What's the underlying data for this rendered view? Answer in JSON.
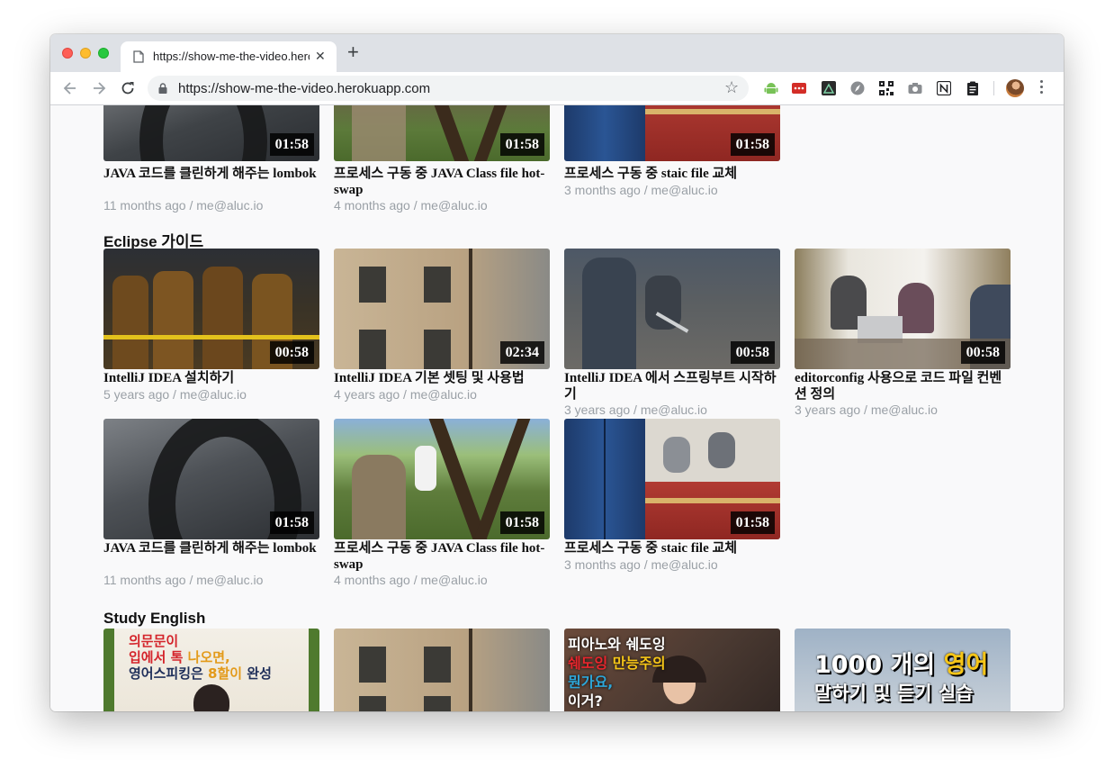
{
  "browser": {
    "tab_title": "https://show-me-the-video.herokuapp.com",
    "url": "https://show-me-the-video.herokuapp.com",
    "tab_close": "✕",
    "new_tab": "+",
    "star": "☆",
    "extensions": [
      "android-icon",
      "lastpass-icon",
      "mountain-icon",
      "compass-icon",
      "qr-code-icon",
      "camera-icon",
      "notion-icon",
      "clipboard-icon"
    ]
  },
  "sections": {
    "top": {
      "videos": [
        {
          "title": "JAVA 코드를 클린하게 해주는 lombok",
          "meta": "11 months ago / me@aluc.io",
          "duration": "01:58"
        },
        {
          "title": "프로세스 구동 중 JAVA Class file hot-swap",
          "meta": "4 months ago / me@aluc.io",
          "duration": "01:58"
        },
        {
          "title": "프로세스 구동 중 staic file 교체",
          "meta": "3 months ago / me@aluc.io",
          "duration": "01:58"
        }
      ]
    },
    "eclipse": {
      "title": "Eclipse 가이드",
      "videos": [
        {
          "title": "IntelliJ IDEA 설치하기",
          "meta": "5 years ago / me@aluc.io",
          "duration": "00:58"
        },
        {
          "title": "IntelliJ IDEA 기본 셋팅 및 사용법",
          "meta": "4 years ago / me@aluc.io",
          "duration": "02:34"
        },
        {
          "title": "IntelliJ IDEA 에서 스프링부트 시작하기",
          "meta": "3 years ago / me@aluc.io",
          "duration": "00:58"
        },
        {
          "title": "editorconfig 사용으로 코드 파일 컨벤션 정의",
          "meta": "3 years ago / me@aluc.io",
          "duration": "00:58"
        },
        {
          "title": "JAVA 코드를 클린하게 해주는 lombok",
          "meta": "11 months ago / me@aluc.io",
          "duration": "01:58"
        },
        {
          "title": "프로세스 구동 중 JAVA Class file hot-swap",
          "meta": "4 months ago / me@aluc.io",
          "duration": "01:58"
        },
        {
          "title": "프로세스 구동 중 staic file 교체",
          "meta": "3 months ago / me@aluc.io",
          "duration": "01:58"
        }
      ]
    },
    "english": {
      "title": "Study English",
      "thumb_texts": {
        "t1_a": "의문문이",
        "t1_b1": "입에서 ",
        "t1_b2": "톡 ",
        "t1_b3": "나오면,",
        "t1_c1": "영어스피킹은 ",
        "t1_c2": "8할이 ",
        "t1_c3": "완성",
        "t3_a": "피아노와 쉐도잉",
        "t3_b1": "쉐도잉 ",
        "t3_b2": "만능주의",
        "t3_c": "뭔가요,",
        "t3_d": "이거?",
        "t4_a1": "1000 개의 ",
        "t4_a2": "영어",
        "t4_b": "말하기 및 듣기 실습"
      }
    }
  }
}
